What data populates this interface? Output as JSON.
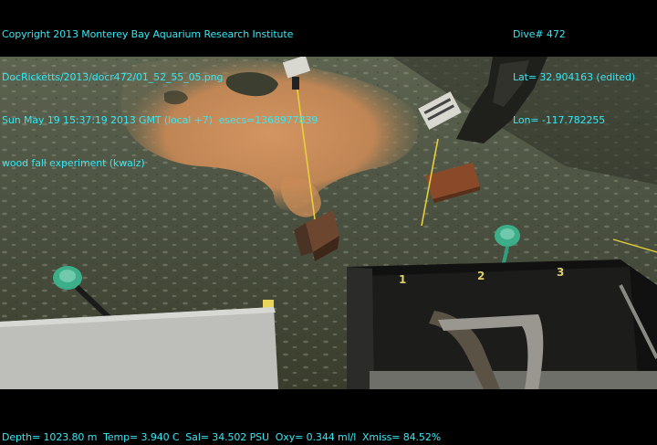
{
  "overlay": {
    "top_left": [
      "Copyright 2013 Monterey Bay Aquarium Research Institute",
      "DocRicketts/2013/docr472/01_52_55_05.png",
      "Sun May 19 15:37:19 2013 GMT (local +7)  esecs=1368977839",
      "wood fall experiment (kwalz)"
    ],
    "top_right": [
      "Dive# 472",
      "Lat= 32.904163 (edited)",
      "Lon= -117.782255"
    ],
    "bottom": "Depth= 1023.80 m  Temp= 3.940 C  Sal= 34.502 PSU  Oxy= 0.344 ml/l  Xmiss= 84.52%"
  },
  "scene": {
    "crate_markers": [
      "1",
      "2",
      "3"
    ]
  },
  "colors": {
    "overlay_text": "#35e8f2",
    "sediment": "#4a5040",
    "bacterial_mat": "#c98a55",
    "rope": "#3cae8a",
    "wood": "#8a4a2a"
  }
}
